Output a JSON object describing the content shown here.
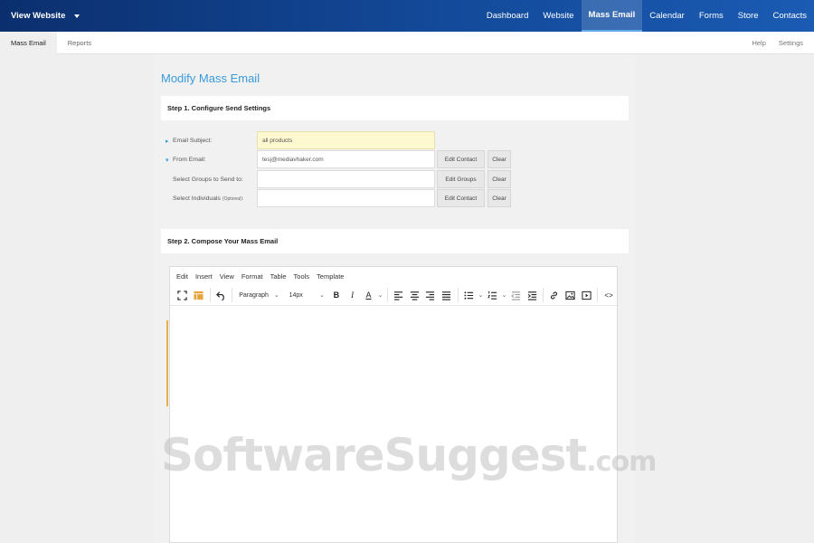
{
  "topbar": {
    "site_switcher": "View Website",
    "nav": [
      "Dashboard",
      "Website",
      "Mass Email",
      "Calendar",
      "Forms",
      "Store",
      "Contacts"
    ],
    "active_nav": "Mass Email"
  },
  "subnav": {
    "tabs": [
      "Mass Email",
      "Reports"
    ],
    "right_links": [
      "Help",
      "Settings"
    ]
  },
  "page": {
    "title": "Modify Mass Email",
    "step1": "Step 1. Configure Send Settings",
    "step2": "Step 2. Compose Your Mass Email"
  },
  "form": {
    "subject_label": "Email Subject:",
    "subject_value": "all products",
    "from_label": "From Email:",
    "from_value": "tesj@mediavhaker.com",
    "groups_label": "Select Groups to Send to:",
    "individuals_label": "Select Individuals",
    "individuals_optional": "(Optional):",
    "edit_contact": "Edit Contact",
    "edit_groups": "Edit Groups",
    "clear": "Clear"
  },
  "editor": {
    "menu": [
      "Edit",
      "Insert",
      "View",
      "Format",
      "Table",
      "Tools",
      "Template"
    ],
    "block_format": "Paragraph",
    "font_size": "14px",
    "bold": "B",
    "italic": "I",
    "text_color": "A",
    "source_code": "<>"
  },
  "watermark": {
    "brand": "SoftwareSuggest",
    "tld": ".com"
  },
  "colors": {
    "accent": "#3a9ad9",
    "nav_dark": "#0b2f6e",
    "highlight_field": "#fdf8cf",
    "editor_orange": "#e8a33a"
  }
}
